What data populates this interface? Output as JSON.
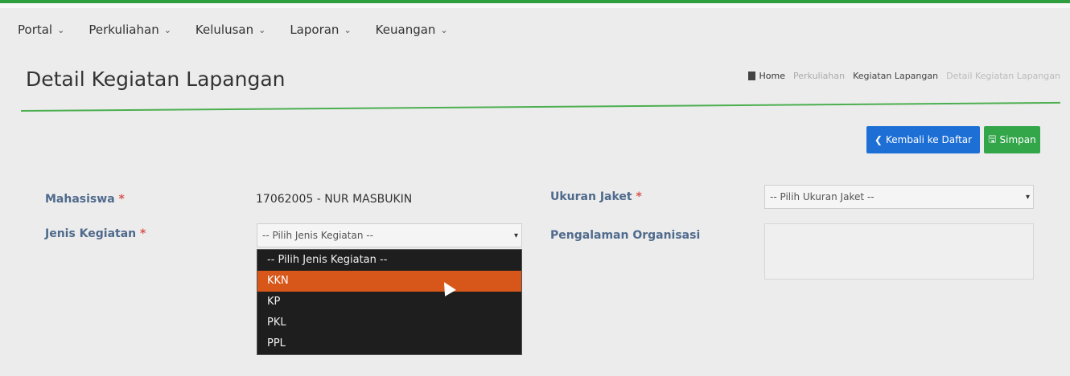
{
  "nav": {
    "items": [
      {
        "label": "Portal"
      },
      {
        "label": "Perkuliahan"
      },
      {
        "label": "Kelulusan"
      },
      {
        "label": "Laporan"
      },
      {
        "label": "Keuangan"
      }
    ]
  },
  "page": {
    "title": "Detail Kegiatan Lapangan"
  },
  "breadcrumb": {
    "home": "Home",
    "items": [
      "Perkuliahan",
      "Kegiatan Lapangan",
      "Detail Kegiatan Lapangan"
    ]
  },
  "actions": {
    "back_label": "Kembali ke Daftar",
    "save_label": "Simpan"
  },
  "form": {
    "mahasiswa_label": "Mahasiswa",
    "mahasiswa_value": "17062005 - NUR MASBUKIN",
    "jenis_label": "Jenis Kegiatan",
    "jenis_selected": "-- Pilih Jenis Kegiatan --",
    "jenis_options": [
      "-- Pilih Jenis Kegiatan --",
      "KKN",
      "KP",
      "PKL",
      "PPL"
    ],
    "jaket_label": "Ukuran Jaket",
    "jaket_selected": "-- Pilih Ukuran Jaket --",
    "organisasi_label": "Pengalaman Organisasi",
    "required_mark": "*"
  },
  "colors": {
    "accent_green": "#2e9e3e",
    "primary_blue": "#1d6fd6",
    "highlight_orange": "#d7571a"
  }
}
